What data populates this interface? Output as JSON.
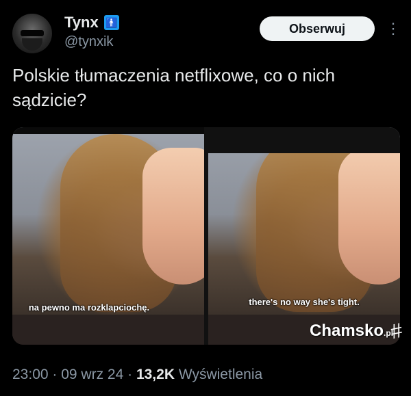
{
  "author": {
    "name": "Tynx",
    "badge": "🚹",
    "handle": "@tynxik"
  },
  "follow_button": "Obserwuj",
  "tweet_text": "Polskie tłumaczenia netflixowe, co o nich sądzicie?",
  "media": {
    "left_subtitle": "na pewno ma rozklapciochę.",
    "right_subtitle": "there's no way she's tight."
  },
  "watermark": {
    "brand": "Chamsko",
    "suffix": ".pl",
    "icon": "#"
  },
  "meta": {
    "time": "23:00",
    "sep1": " · ",
    "date": "09 wrz 24",
    "sep2": " · ",
    "views_count": "13,2K",
    "views_label": " Wyświetlenia"
  },
  "colors": {
    "background": "#000000",
    "text": "#e7e9ea",
    "muted": "#8b98a5",
    "follow_bg": "#eff3f4",
    "badge": "#1d9bf0"
  }
}
